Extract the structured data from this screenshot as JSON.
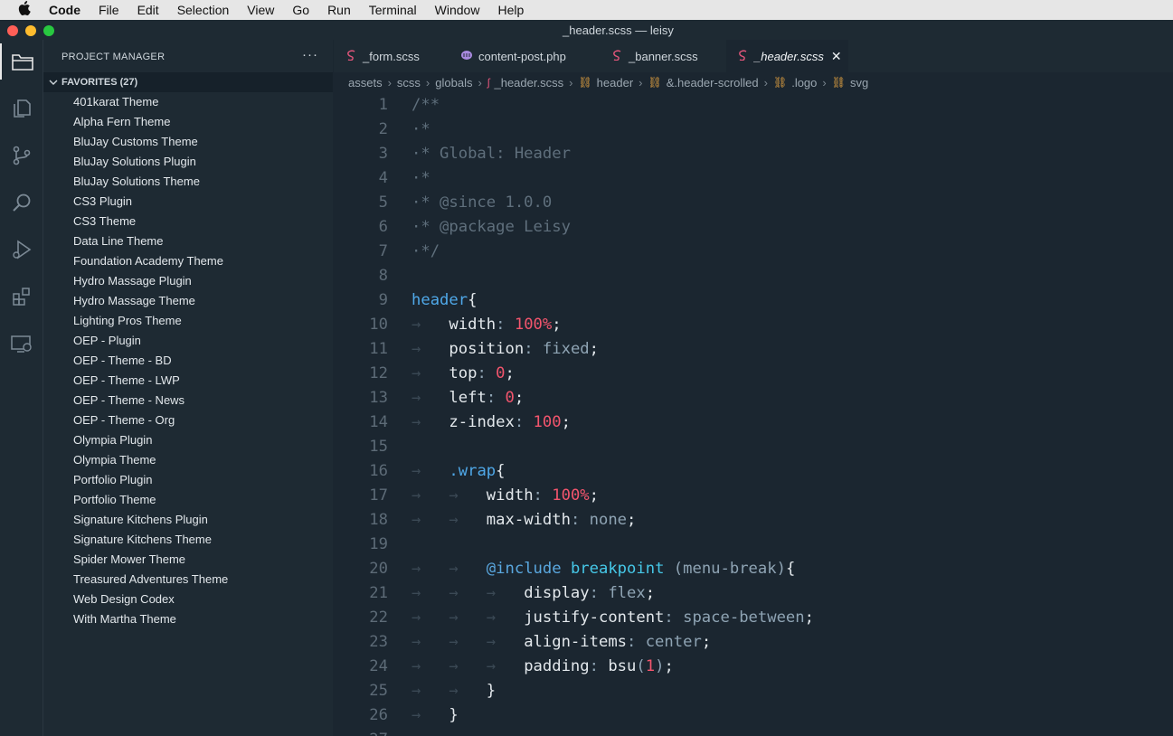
{
  "menubar": {
    "app": "Code",
    "items": [
      "File",
      "Edit",
      "Selection",
      "View",
      "Go",
      "Run",
      "Terminal",
      "Window",
      "Help"
    ]
  },
  "window": {
    "title": "_header.scss — leisy",
    "traffic_colors": [
      "#ff5f57",
      "#febc2e",
      "#28c840"
    ]
  },
  "activity_bar": {
    "icons": [
      "project-manager-icon",
      "explorer-icon",
      "source-control-icon",
      "search-icon",
      "run-debug-icon",
      "extensions-icon",
      "remote-explorer-icon"
    ]
  },
  "sidebar": {
    "title": "PROJECT MANAGER",
    "more": "···",
    "section": "FAVORITES (27)",
    "projects": [
      "401karat Theme",
      "Alpha Fern Theme",
      "BluJay Customs Theme",
      "BluJay Solutions Plugin",
      "BluJay Solutions Theme",
      "CS3 Plugin",
      "CS3 Theme",
      "Data Line Theme",
      "Foundation Academy Theme",
      "Hydro Massage Plugin",
      "Hydro Massage Theme",
      "Lighting Pros Theme",
      "OEP - Plugin",
      "OEP - Theme - BD",
      "OEP - Theme - LWP",
      "OEP - Theme - News",
      "OEP - Theme - Org",
      "Olympia Plugin",
      "Olympia Theme",
      "Portfolio Plugin",
      "Portfolio Theme",
      "Signature Kitchens Plugin",
      "Signature Kitchens Theme",
      "Spider Mower Theme",
      "Treasured Adventures Theme",
      "Web Design Codex",
      "With Martha Theme"
    ]
  },
  "tabs": [
    {
      "label": "_form.scss",
      "icon": "sass-icon",
      "active": false
    },
    {
      "label": "content-post.php",
      "icon": "php-icon",
      "active": false
    },
    {
      "label": "_banner.scss",
      "icon": "sass-icon",
      "active": false
    },
    {
      "label": "_header.scss",
      "icon": "sass-icon",
      "active": true
    }
  ],
  "breadcrumb": [
    "assets",
    "scss",
    "globals",
    "_header.scss",
    "header",
    "&.header-scrolled",
    ".logo",
    "svg"
  ],
  "colors": {
    "accent_sass": "#e0557a",
    "breadcrumb_symbol": "#e0a040",
    "editor_bg": "#1b2630",
    "sidebar_bg": "#1e2a33"
  },
  "code": {
    "lines": [
      {
        "n": "1",
        "tokens": [
          [
            "c-com",
            "/**"
          ]
        ]
      },
      {
        "n": "2",
        "tokens": [
          [
            "c-com",
            "·*"
          ]
        ]
      },
      {
        "n": "3",
        "tokens": [
          [
            "c-com",
            "·* Global: Header"
          ]
        ]
      },
      {
        "n": "4",
        "tokens": [
          [
            "c-com",
            "·*"
          ]
        ]
      },
      {
        "n": "5",
        "tokens": [
          [
            "c-com",
            "·* @since 1.0.0"
          ]
        ]
      },
      {
        "n": "6",
        "tokens": [
          [
            "c-com",
            "·* @package Leisy"
          ]
        ]
      },
      {
        "n": "7",
        "tokens": [
          [
            "c-com",
            "·*/"
          ]
        ]
      },
      {
        "n": "8",
        "tokens": []
      },
      {
        "n": "9",
        "tokens": [
          [
            "c-sel",
            "header"
          ],
          [
            "c-prop",
            "{"
          ]
        ]
      },
      {
        "n": "10",
        "tokens": [
          [
            "c-ws",
            "→   "
          ],
          [
            "c-prop",
            "width"
          ],
          [
            "c-val",
            ": "
          ],
          [
            "c-num",
            "100%"
          ],
          [
            "c-prop",
            ";"
          ]
        ]
      },
      {
        "n": "11",
        "tokens": [
          [
            "c-ws",
            "→   "
          ],
          [
            "c-prop",
            "position"
          ],
          [
            "c-val",
            ": fixed"
          ],
          [
            "c-prop",
            ";"
          ]
        ]
      },
      {
        "n": "12",
        "tokens": [
          [
            "c-ws",
            "→   "
          ],
          [
            "c-prop",
            "top"
          ],
          [
            "c-val",
            ": "
          ],
          [
            "c-num",
            "0"
          ],
          [
            "c-prop",
            ";"
          ]
        ]
      },
      {
        "n": "13",
        "tokens": [
          [
            "c-ws",
            "→   "
          ],
          [
            "c-prop",
            "left"
          ],
          [
            "c-val",
            ": "
          ],
          [
            "c-num",
            "0"
          ],
          [
            "c-prop",
            ";"
          ]
        ]
      },
      {
        "n": "14",
        "tokens": [
          [
            "c-ws",
            "→   "
          ],
          [
            "c-prop",
            "z-index"
          ],
          [
            "c-val",
            ": "
          ],
          [
            "c-num",
            "100"
          ],
          [
            "c-prop",
            ";"
          ]
        ]
      },
      {
        "n": "15",
        "tokens": []
      },
      {
        "n": "16",
        "tokens": [
          [
            "c-ws",
            "→   "
          ],
          [
            "c-sel",
            ".wrap"
          ],
          [
            "c-prop",
            "{"
          ]
        ]
      },
      {
        "n": "17",
        "tokens": [
          [
            "c-ws",
            "→   →   "
          ],
          [
            "c-prop",
            "width"
          ],
          [
            "c-val",
            ": "
          ],
          [
            "c-num",
            "100%"
          ],
          [
            "c-prop",
            ";"
          ]
        ]
      },
      {
        "n": "18",
        "tokens": [
          [
            "c-ws",
            "→   →   "
          ],
          [
            "c-prop",
            "max-width"
          ],
          [
            "c-val",
            ": none"
          ],
          [
            "c-prop",
            ";"
          ]
        ]
      },
      {
        "n": "19",
        "tokens": []
      },
      {
        "n": "20",
        "tokens": [
          [
            "c-ws",
            "→   →   "
          ],
          [
            "c-inc",
            "@include "
          ],
          [
            "c-kw",
            "breakpoint"
          ],
          [
            "c-val",
            " (menu-break)"
          ],
          [
            "c-prop",
            "{"
          ]
        ]
      },
      {
        "n": "21",
        "tokens": [
          [
            "c-ws",
            "→   →   →   "
          ],
          [
            "c-prop",
            "display"
          ],
          [
            "c-val",
            ": flex"
          ],
          [
            "c-prop",
            ";"
          ]
        ]
      },
      {
        "n": "22",
        "tokens": [
          [
            "c-ws",
            "→   →   →   "
          ],
          [
            "c-prop",
            "justify-content"
          ],
          [
            "c-val",
            ": space-between"
          ],
          [
            "c-prop",
            ";"
          ]
        ]
      },
      {
        "n": "23",
        "tokens": [
          [
            "c-ws",
            "→   →   →   "
          ],
          [
            "c-prop",
            "align-items"
          ],
          [
            "c-val",
            ": center"
          ],
          [
            "c-prop",
            ";"
          ]
        ]
      },
      {
        "n": "24",
        "tokens": [
          [
            "c-ws",
            "→   →   →   "
          ],
          [
            "c-prop",
            "padding"
          ],
          [
            "c-val",
            ": "
          ],
          [
            "c-prop",
            "bsu"
          ],
          [
            "c-val",
            "("
          ],
          [
            "c-num",
            "1"
          ],
          [
            "c-val",
            ")"
          ],
          [
            "c-prop",
            ";"
          ]
        ]
      },
      {
        "n": "25",
        "tokens": [
          [
            "c-ws",
            "→   →   "
          ],
          [
            "c-prop",
            "}"
          ]
        ]
      },
      {
        "n": "26",
        "tokens": [
          [
            "c-ws",
            "→   "
          ],
          [
            "c-prop",
            "}"
          ]
        ]
      },
      {
        "n": "27",
        "tokens": []
      }
    ]
  }
}
